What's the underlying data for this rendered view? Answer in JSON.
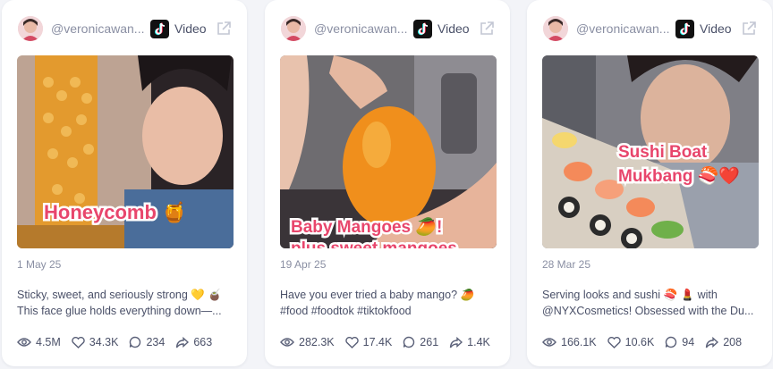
{
  "cards": [
    {
      "handle": "@veronicawan...",
      "platform": "Video",
      "overlay_lines": [
        "Honeycomb 🍯"
      ],
      "date": "1 May 25",
      "caption_lines": [
        "Sticky, sweet, and seriously strong 💛 🧉",
        "This face glue holds everything down—..."
      ],
      "views": "4.5M",
      "likes": "34.3K",
      "comments": "234",
      "shares": "663"
    },
    {
      "handle": "@veronicawan...",
      "platform": "Video",
      "overlay_lines": [
        "Baby Mangoes 🥭!",
        "plus sweet mangoes"
      ],
      "date": "19 Apr 25",
      "caption_lines": [
        "Have you ever tried a baby mango? 🥭",
        "#food #foodtok #tiktokfood"
      ],
      "views": "282.3K",
      "likes": "17.4K",
      "comments": "261",
      "shares": "1.4K"
    },
    {
      "handle": "@veronicawan...",
      "platform": "Video",
      "overlay_lines": [
        "Sushi Boat",
        "Mukbang 🍣❤️"
      ],
      "date": "28 Mar 25",
      "caption_lines": [
        "Serving looks and sushi 🍣 💄 with",
        "@NYXCosmetics! Obsessed with the Du..."
      ],
      "views": "166.1K",
      "likes": "10.6K",
      "comments": "94",
      "shares": "208"
    }
  ],
  "colors": {
    "overlay_pink": "#e8466c",
    "muted": "#8a8fa3",
    "text": "#4a5068"
  }
}
